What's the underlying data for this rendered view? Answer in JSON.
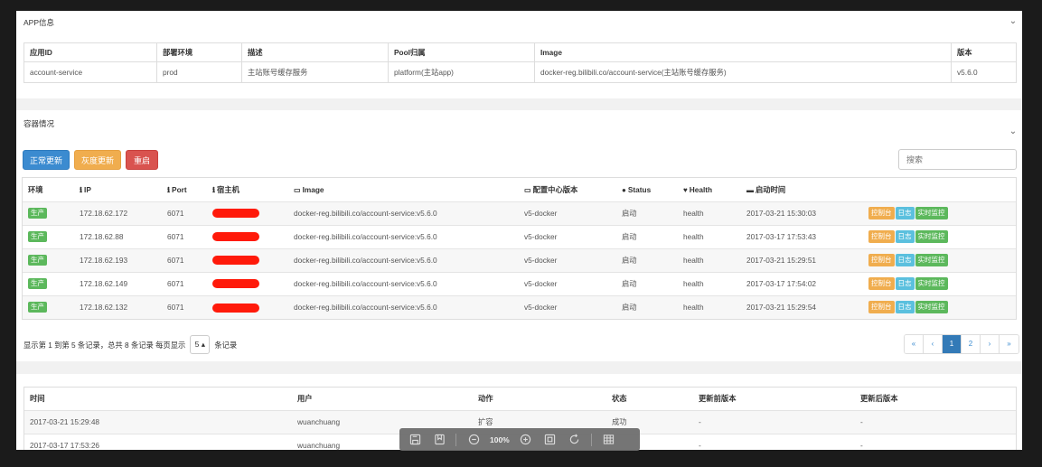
{
  "app_info": {
    "title": "APP信息",
    "headers": [
      "应用ID",
      "部署环境",
      "描述",
      "Pool归属",
      "Image",
      "版本"
    ],
    "row": [
      "account-service",
      "prod",
      "主站账号缓存服务",
      "platform(主站app)",
      "docker-reg.bilibili.co/account-service(主站账号缓存服务)",
      "v5.6.0"
    ]
  },
  "containers": {
    "title": "容器情况",
    "buttons": {
      "normal_update": "正常更新",
      "gray_update": "灰度更新",
      "restart": "重启"
    },
    "search_placeholder": "搜索",
    "headers": {
      "env": "环境",
      "ip": "IP",
      "port": "Port",
      "host": "宿主机",
      "image": "Image",
      "config_version": "配置中心版本",
      "status": "Status",
      "health": "Health",
      "start_time": "启动时间"
    },
    "rows": [
      {
        "env": "生产",
        "ip": "172.18.62.172",
        "port": "6071",
        "image": "docker-reg.bilibili.co/account-service:v5.6.0",
        "config": "v5-docker",
        "status": "启动",
        "health": "health",
        "time": "2017-03-21 15:30:03"
      },
      {
        "env": "生产",
        "ip": "172.18.62.88",
        "port": "6071",
        "image": "docker-reg.bilibili.co/account-service:v5.6.0",
        "config": "v5-docker",
        "status": "启动",
        "health": "health",
        "time": "2017-03-17 17:53:43"
      },
      {
        "env": "生产",
        "ip": "172.18.62.193",
        "port": "6071",
        "image": "docker-reg.bilibili.co/account-service:v5.6.0",
        "config": "v5-docker",
        "status": "启动",
        "health": "health",
        "time": "2017-03-21 15:29:51"
      },
      {
        "env": "生产",
        "ip": "172.18.62.149",
        "port": "6071",
        "image": "docker-reg.bilibili.co/account-service:v5.6.0",
        "config": "v5-docker",
        "status": "启动",
        "health": "health",
        "time": "2017-03-17 17:54:02"
      },
      {
        "env": "生产",
        "ip": "172.18.62.132",
        "port": "6071",
        "image": "docker-reg.bilibili.co/account-service:v5.6.0",
        "config": "v5-docker",
        "status": "启动",
        "health": "health",
        "time": "2017-03-21 15:29:54"
      }
    ],
    "actions": {
      "console": "控制台",
      "log": "日志",
      "monitor": "实时监控"
    },
    "pagination": {
      "info_prefix": "显示第 1 到第 5 条记录，总共 8 条记录 每页显示",
      "page_size": "5 ▴",
      "info_suffix": "条记录",
      "pages": [
        "«",
        "‹",
        "1",
        "2",
        "›",
        "»"
      ],
      "active_page": "1"
    }
  },
  "log": {
    "headers": [
      "时间",
      "用户",
      "动作",
      "状态",
      "更新前版本",
      "更新后版本"
    ],
    "rows": [
      [
        "2017-03-21 15:29:48",
        "wuanchuang",
        "扩容",
        "成功",
        "-",
        "-"
      ],
      [
        "2017-03-17 17:53:26",
        "wuanchuang",
        "",
        "",
        "-",
        "-"
      ]
    ]
  },
  "toolbar": {
    "zoom": "100%"
  }
}
